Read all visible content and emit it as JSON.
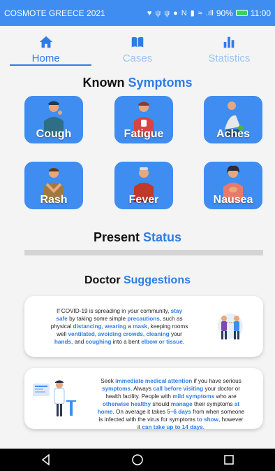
{
  "status_bar": {
    "carrier": "COSMOTE GREECE 2021",
    "battery": "90%",
    "time": "11:00",
    "signal_text": ".ıll",
    "icons": [
      "heart-icon",
      "usb-icon",
      "usb-icon",
      "messenger-icon",
      "nfc-icon",
      "vibrate-icon",
      "wifi-icon",
      "signal-icon",
      "battery-icon"
    ]
  },
  "tabs": [
    {
      "label": "Home",
      "icon": "home-icon",
      "active": true
    },
    {
      "label": "Cases",
      "icon": "book-icon",
      "active": false
    },
    {
      "label": "Statistics",
      "icon": "bar-chart-icon",
      "active": false
    }
  ],
  "symptoms": {
    "title_a": "Known ",
    "title_b": "Symptoms",
    "items": [
      {
        "label": "Cough"
      },
      {
        "label": "Fatigue"
      },
      {
        "label": "Aches"
      },
      {
        "label": "Rash"
      },
      {
        "label": "Fever"
      },
      {
        "label": "Nausea"
      }
    ]
  },
  "status": {
    "title_a": "Present ",
    "title_b": "Status",
    "progress": 0
  },
  "suggestions": {
    "title_a": "Doctor ",
    "title_b": "Suggestions"
  },
  "card1": {
    "s1": "If COVID-19 is spreading in your community, ",
    "h1": "stay",
    "h2": "safe",
    "s2": " by taking some simple ",
    "h3": "precautions",
    "s3": ", such as",
    "s4": "physical ",
    "h4": "distancing",
    "s5": ", ",
    "h5": "wearing",
    "s6": " a ",
    "h6": "mask",
    "s7": ", keeping rooms",
    "s8": "well ",
    "h7": "ventilated",
    "s9": ", ",
    "h8": "avoiding crowds",
    "s10": ", ",
    "h9": "cleaning",
    "s11": " your",
    "h10": "hands",
    "s12": ", and ",
    "h11": "coughing",
    "s13": " into a bent ",
    "h12": "elbow or tissue",
    "s14": "."
  },
  "card2": {
    "s1": "Seek ",
    "h1": "immediate medical attention",
    "s2": " if you have serious",
    "h2": "symptoms",
    "s3": ". Always ",
    "h3": "call before visiting",
    "s4": " your doctor or",
    "s5": "health facility. People with ",
    "h4": "mild symptoms",
    "s6": " who are",
    "h5": "otherwise healthy",
    "s7": " should ",
    "h6": "manage",
    "s8": " their symptoms ",
    "h7": "at",
    "h8": "home",
    "s9": ". On average it takes ",
    "h9": "5–6 days",
    "s10": " from when someone",
    "s11": "is infected with the virus for symptoms ",
    "h10": "to show",
    "s12": ", however",
    "s13": "it ",
    "h11": "can take up to 14 days",
    "s14": "."
  },
  "colors": {
    "accent": "#2e7de6",
    "tile": "#3f8df0",
    "statusbar": "#3f8df0"
  }
}
